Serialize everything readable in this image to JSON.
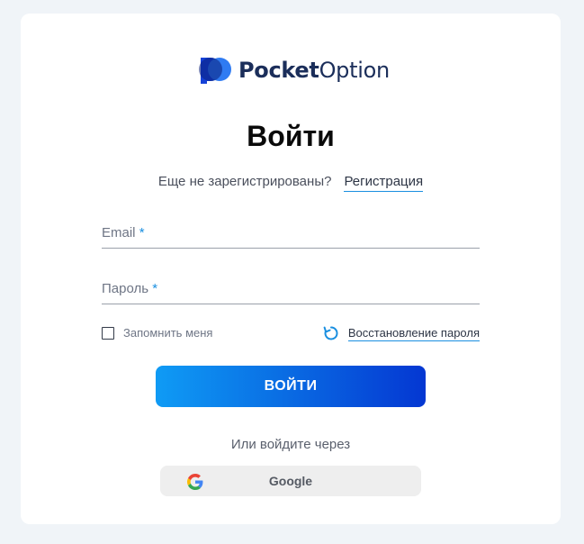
{
  "logo": {
    "part1": "Pocket",
    "part2": "Option"
  },
  "title": "Войти",
  "register": {
    "prompt": "Еще не зарегистрированы?",
    "link": "Регистрация"
  },
  "form": {
    "email_label": "Email",
    "password_label": "Пароль",
    "required_mark": "*",
    "remember_label": "Запомнить меня",
    "remember_checked": false,
    "recover_label": "Восстановление пароля",
    "submit_label": "ВОЙТИ"
  },
  "alt_login": {
    "label": "Или войдите через",
    "google_label": "Google"
  },
  "icons": {
    "logo": "pocket-option-logo-icon",
    "recover": "refresh-icon",
    "google": "google-g-icon"
  },
  "colors": {
    "brand_navy": "#1b2e5a",
    "accent_blue": "#1a8fe0",
    "button_gradient_start": "#0f9bf5",
    "button_gradient_end": "#0437d2"
  }
}
